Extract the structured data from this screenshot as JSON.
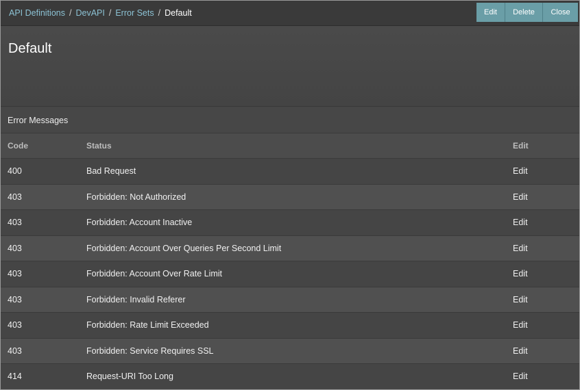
{
  "breadcrumb": {
    "items": [
      {
        "label": "API Definitions"
      },
      {
        "label": "DevAPI"
      },
      {
        "label": "Error Sets"
      }
    ],
    "separator": "/",
    "current": "Default"
  },
  "toolbar": {
    "edit_label": "Edit",
    "delete_label": "Delete",
    "close_label": "Close"
  },
  "page": {
    "title": "Default"
  },
  "section": {
    "title": "Error Messages"
  },
  "table": {
    "headers": {
      "code": "Code",
      "status": "Status",
      "edit": "Edit"
    },
    "rows": [
      {
        "code": "400",
        "status": "Bad Request",
        "edit": "Edit"
      },
      {
        "code": "403",
        "status": "Forbidden: Not Authorized",
        "edit": "Edit"
      },
      {
        "code": "403",
        "status": "Forbidden: Account Inactive",
        "edit": "Edit"
      },
      {
        "code": "403",
        "status": "Forbidden: Account Over Queries Per Second Limit",
        "edit": "Edit"
      },
      {
        "code": "403",
        "status": "Forbidden: Account Over Rate Limit",
        "edit": "Edit"
      },
      {
        "code": "403",
        "status": "Forbidden: Invalid Referer",
        "edit": "Edit"
      },
      {
        "code": "403",
        "status": "Forbidden: Rate Limit Exceeded",
        "edit": "Edit"
      },
      {
        "code": "403",
        "status": "Forbidden: Service Requires SSL",
        "edit": "Edit"
      },
      {
        "code": "414",
        "status": "Request-URI Too Long",
        "edit": "Edit"
      }
    ]
  },
  "colors": {
    "accent": "#6a9ea7",
    "link": "#8cc2d4",
    "background": "#4a4a4a"
  }
}
